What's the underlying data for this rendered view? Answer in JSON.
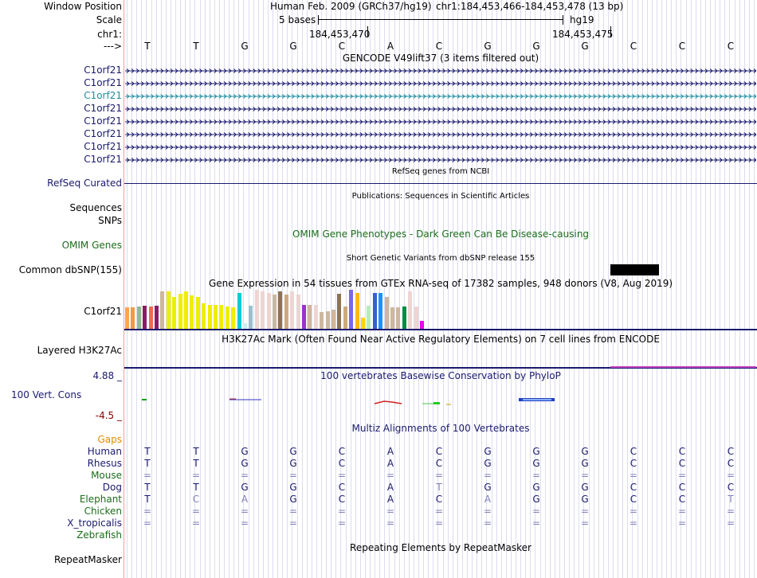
{
  "header": {
    "window_position_label": "Window Position",
    "scale_label": "Scale",
    "chrom_label": "chr1:",
    "arrow_label": "--->",
    "genome": "Human Feb. 2009 (GRCh37/hg19)",
    "position": "chr1:184,453,466-184,453,478 (13 bp)",
    "scale_text": "5 bases",
    "assembly": "hg19",
    "coord_left": "184,453,470",
    "coord_right": "184,453,475"
  },
  "sequence": [
    "T",
    "T",
    "G",
    "G",
    "C",
    "A",
    "C",
    "G",
    "G",
    "G",
    "C",
    "C",
    "C"
  ],
  "gencode": {
    "title": "GENCODE V49lift37 (3 items filtered out)",
    "rows": [
      {
        "name": "C1orf21",
        "color": "#1a1a6e"
      },
      {
        "name": "C1orf21",
        "color": "#1a1a6e"
      },
      {
        "name": "C1orf21",
        "color": "#1e8fa0"
      },
      {
        "name": "C1orf21",
        "color": "#1a1a6e"
      },
      {
        "name": "C1orf21",
        "color": "#1a1a6e"
      },
      {
        "name": "C1orf21",
        "color": "#1a1a6e"
      },
      {
        "name": "C1orf21",
        "color": "#1a1a6e"
      },
      {
        "name": "C1orf21",
        "color": "#1a1a6e"
      }
    ]
  },
  "refseq": {
    "title": "RefSeq genes from NCBI",
    "label": "RefSeq Curated"
  },
  "publications": {
    "title": "Publications: Sequences in Scientific Articles",
    "label1": "Sequences",
    "label2": "SNPs"
  },
  "omim": {
    "label": "OMIM Genes",
    "title": "OMIM Gene Phenotypes - Dark Green Can Be Disease-causing"
  },
  "dbsnp": {
    "title": "Short Genetic Variants from dbSNP release 155",
    "label": "Common dbSNP(155)"
  },
  "gtex": {
    "title": "Gene Expression in 54 tissues from GTEx RNA-seq of 17382 samples, 948 donors (V8, Aug 2019)",
    "label": "C1orf21",
    "bars": [
      {
        "c": "#ffa54f",
        "v": 0.55
      },
      {
        "c": "#ee9a49",
        "v": 0.55
      },
      {
        "c": "#8fbc8f",
        "v": 0.58
      },
      {
        "c": "#8b1c62",
        "v": 0.6
      },
      {
        "c": "#ee6a50",
        "v": 0.58
      },
      {
        "c": "#8b1c62",
        "v": 0.6
      },
      {
        "c": "#cdb79e",
        "v": 0.95
      },
      {
        "c": "#eeee00",
        "v": 0.95
      },
      {
        "c": "#eeee00",
        "v": 0.82
      },
      {
        "c": "#eeee00",
        "v": 0.9
      },
      {
        "c": "#eeee00",
        "v": 0.95
      },
      {
        "c": "#eeee00",
        "v": 0.85
      },
      {
        "c": "#eeee00",
        "v": 0.82
      },
      {
        "c": "#eeee00",
        "v": 0.65
      },
      {
        "c": "#eeee00",
        "v": 0.62
      },
      {
        "c": "#eeee00",
        "v": 0.62
      },
      {
        "c": "#eeee00",
        "v": 0.62
      },
      {
        "c": "#eeee00",
        "v": 0.58
      },
      {
        "c": "#eeee00",
        "v": 0.55
      },
      {
        "c": "#00ced1",
        "v": 0.92
      },
      {
        "c": "#ccefef",
        "v": 0.15
      },
      {
        "c": "#9ac0cd",
        "v": 0.6
      },
      {
        "c": "#eed5d2",
        "v": 1.0
      },
      {
        "c": "#eed5d2",
        "v": 0.95
      },
      {
        "c": "#eed5d2",
        "v": 0.92
      },
      {
        "c": "#cdb79e",
        "v": 0.88
      },
      {
        "c": "#8b7355",
        "v": 0.95
      },
      {
        "c": "#cdaa7d",
        "v": 0.88
      },
      {
        "c": "#eed5d2",
        "v": 0.95
      },
      {
        "c": "#eed5d2",
        "v": 0.88
      },
      {
        "c": "#9a32cd",
        "v": 0.62
      },
      {
        "c": "#cdb79e",
        "v": 0.62
      },
      {
        "c": "#eed5d2",
        "v": 0.62
      },
      {
        "c": "#cdb79e",
        "v": 0.42
      },
      {
        "c": "#cdb79e",
        "v": 0.45
      },
      {
        "c": "#cdb79e",
        "v": 0.48
      },
      {
        "c": "#8b7355",
        "v": 0.9
      },
      {
        "c": "#cdaa7d",
        "v": 0.58
      },
      {
        "c": "#7a67ee",
        "v": 1.0
      },
      {
        "c": "#ffb90f",
        "v": 0.92
      },
      {
        "c": "#ffd700",
        "v": 0.28
      },
      {
        "c": "#b4eeb4",
        "v": 0.6
      },
      {
        "c": "#3a5fcd",
        "v": 0.92
      },
      {
        "c": "#1e90ff",
        "v": 0.92
      },
      {
        "c": "#cdb79e",
        "v": 0.82
      },
      {
        "c": "#cdb79e",
        "v": 0.55
      },
      {
        "c": "#cdb79e",
        "v": 0.55
      },
      {
        "c": "#008b45",
        "v": 0.58
      },
      {
        "c": "#eed5d2",
        "v": 0.95
      },
      {
        "c": "#eed5d2",
        "v": 0.58
      },
      {
        "c": "#ee00ee",
        "v": 0.2
      }
    ]
  },
  "h3k27ac": {
    "label": "Layered H3K27Ac",
    "title": "H3K27Ac Mark (Often Found Near Active Regulatory Elements) on 7 cell lines from ENCODE"
  },
  "phylop": {
    "label": "100 Vert. Cons",
    "max": "4.88 _",
    "min": "-4.5 _",
    "title": "100 vertebrates Basewise Conservation by PhyloP"
  },
  "multiz": {
    "title": "Multiz Alignments of 100 Vertebrates",
    "gaps_label": "Gaps",
    "species": [
      {
        "name": "Human",
        "color": "#1a1a6e",
        "bases": [
          "T",
          "T",
          "G",
          "G",
          "C",
          "A",
          "C",
          "G",
          "G",
          "G",
          "C",
          "C",
          "C"
        ],
        "faint": []
      },
      {
        "name": "Rhesus",
        "color": "#1a1a6e",
        "bases": [
          "T",
          "T",
          "G",
          "G",
          "C",
          "A",
          "C",
          "G",
          "G",
          "G",
          "C",
          "C",
          "C"
        ],
        "faint": []
      },
      {
        "name": "Mouse",
        "color": "#1a6e1a",
        "bases": [
          "=",
          "=",
          "=",
          "=",
          "=",
          "=",
          "=",
          "=",
          "=",
          "=",
          "=",
          "=",
          "="
        ],
        "faint": [
          0,
          1,
          2,
          3,
          4,
          5,
          6,
          7,
          8,
          9,
          10,
          11,
          12
        ]
      },
      {
        "name": "Dog",
        "color": "#1a1a6e",
        "bases": [
          "T",
          "T",
          "G",
          "G",
          "C",
          "A",
          "T",
          "G",
          "G",
          "G",
          "C",
          "C",
          "C"
        ],
        "faint": [
          6
        ]
      },
      {
        "name": "Elephant",
        "color": "#1a6e1a",
        "bases": [
          "T",
          "C",
          "A",
          "G",
          "C",
          "A",
          "C",
          "A",
          "G",
          "G",
          "C",
          "C",
          "T"
        ],
        "faint": [
          1,
          2,
          7,
          12
        ]
      },
      {
        "name": "Chicken",
        "color": "#1a6e1a",
        "bases": [
          "=",
          "=",
          "=",
          "=",
          "=",
          "=",
          "=",
          "=",
          "=",
          "=",
          "=",
          "=",
          "="
        ],
        "faint": [
          0,
          1,
          2,
          3,
          4,
          5,
          6,
          7,
          8,
          9,
          10,
          11,
          12
        ]
      },
      {
        "name": "X_tropicalis",
        "color": "#1a1a6e",
        "bases": [
          "=",
          "=",
          "=",
          "=",
          "=",
          "=",
          "=",
          "=",
          "=",
          "=",
          "=",
          "=",
          "="
        ],
        "faint": [
          0,
          1,
          2,
          3,
          4,
          5,
          6,
          7,
          8,
          9,
          10,
          11,
          12
        ]
      },
      {
        "name": "Zebrafish",
        "color": "#1a6e1a",
        "bases": [],
        "faint": []
      }
    ]
  },
  "repeatmasker": {
    "label": "RepeatMasker",
    "title": "Repeating Elements by RepeatMasker"
  }
}
